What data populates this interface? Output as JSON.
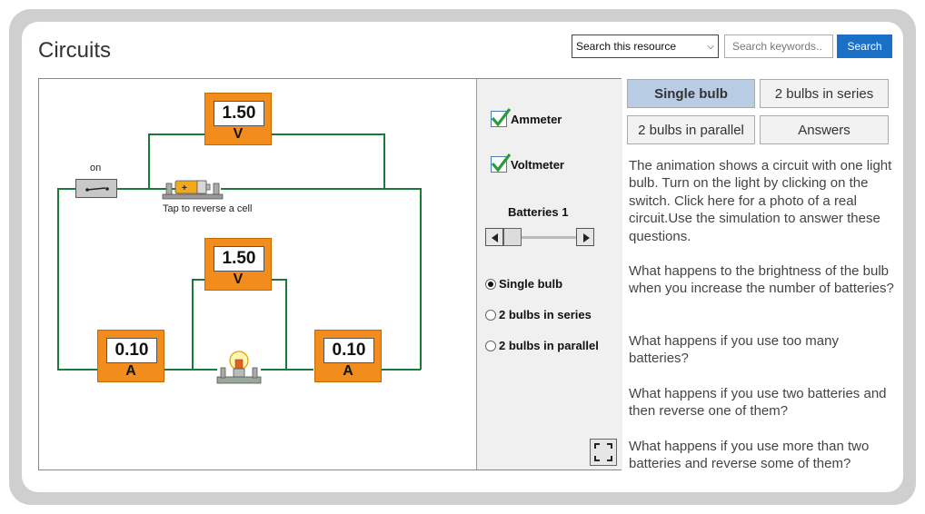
{
  "header": {
    "title": "Circuits",
    "search_scope": "Search this resource",
    "search_placeholder": "Search keywords..",
    "search_button": "Search"
  },
  "simulation": {
    "switch_label": "on",
    "cell_hint": "Tap to reverse a cell",
    "meters": {
      "voltmeter_top": {
        "value": "1.50",
        "unit": "V"
      },
      "voltmeter_bulb": {
        "value": "1.50",
        "unit": "V"
      },
      "ammeter_left": {
        "value": "0.10",
        "unit": "A"
      },
      "ammeter_right": {
        "value": "0.10",
        "unit": "A"
      }
    },
    "controls": {
      "ammeter_label": "Ammeter",
      "voltmeter_label": "Voltmeter",
      "batteries_label": "Batteries 1",
      "radio_single": "Single bulb",
      "radio_series": "2 bulbs in series",
      "radio_parallel": "2 bulbs in parallel"
    }
  },
  "tabs": {
    "single": "Single bulb",
    "series": "2 bulbs in series",
    "parallel": "2 bulbs in parallel",
    "answers": "Answers"
  },
  "description": {
    "intro": "The animation shows a circuit with one light bulb. Turn on the light by clicking on the switch. Click here for a photo of a real circuit.Use the simulation to answer these questions.",
    "q1": "What happens to the brightness of the bulb when you increase the number of batteries?",
    "q2": "What happens if you use too many batteries?",
    "q3": "What happens if you use two batteries and then reverse one of them?",
    "q4": "What happens if you use more than two batteries and reverse some of them?"
  },
  "colors": {
    "wire": "#1a7a3a",
    "meter": "#f28c1c",
    "search_button": "#1a6fc7",
    "active_tab": "#b8cce4"
  }
}
